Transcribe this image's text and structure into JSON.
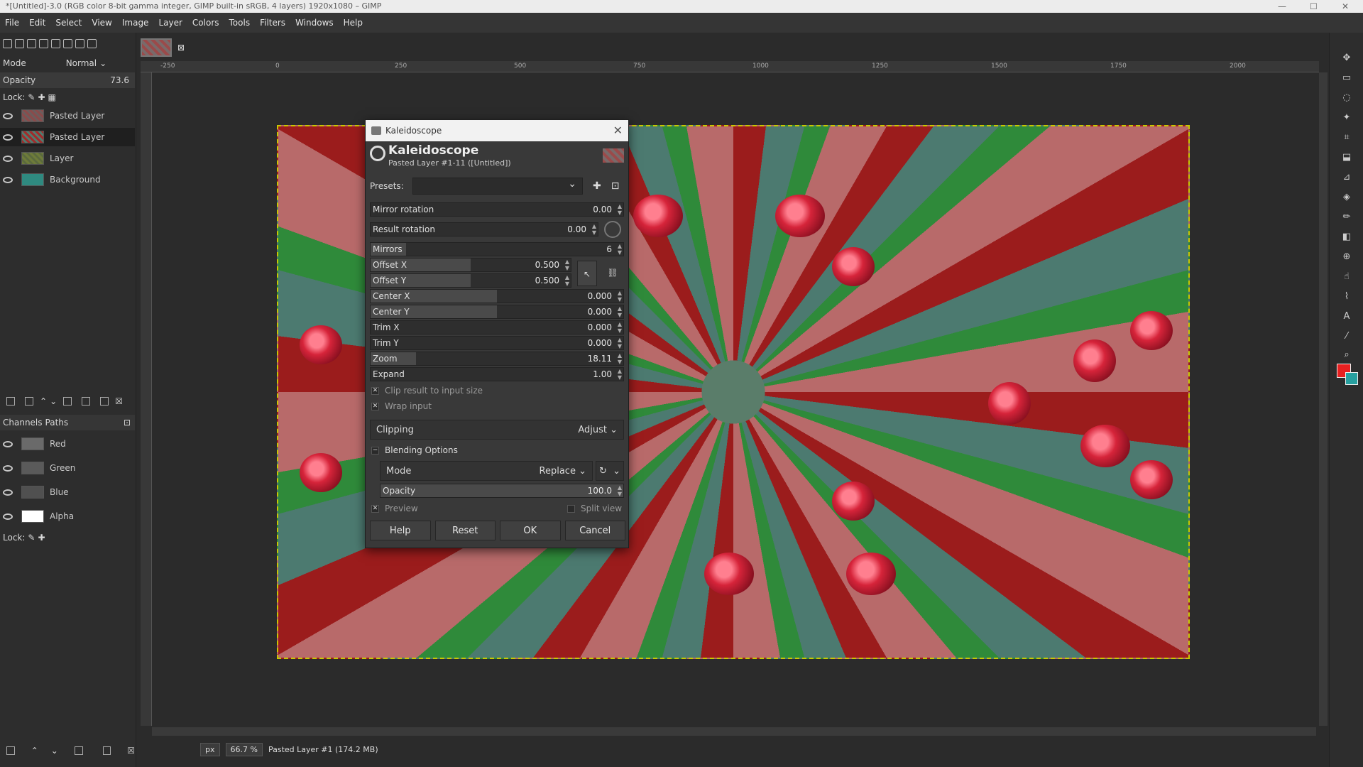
{
  "window": {
    "title": "*[Untitled]-3.0 (RGB color 8-bit gamma integer, GIMP built-in sRGB, 4 layers) 1920x1080 – GIMP"
  },
  "menu": [
    "File",
    "Edit",
    "Select",
    "View",
    "Image",
    "Layer",
    "Colors",
    "Tools",
    "Filters",
    "Windows",
    "Help"
  ],
  "layers_panel": {
    "mode_label": "Mode",
    "mode_value": "Normal",
    "opacity_label": "Opacity",
    "opacity_value": "73.6",
    "lock_label": "Lock:",
    "layers": [
      {
        "name": "Pasted Layer"
      },
      {
        "name": "Pasted Layer"
      },
      {
        "name": "Layer"
      },
      {
        "name": "Background"
      }
    ]
  },
  "channels_panel": {
    "tabs": [
      "Channels",
      "Paths"
    ],
    "channels": [
      {
        "name": "Red"
      },
      {
        "name": "Green"
      },
      {
        "name": "Blue"
      },
      {
        "name": "Alpha"
      }
    ],
    "lock_label": "Lock:"
  },
  "ruler": {
    "ticks": [
      "-250",
      "0",
      "250",
      "500",
      "750",
      "1000",
      "1250",
      "1500",
      "1750",
      "2000"
    ]
  },
  "status": {
    "unit": "px",
    "zoom": "66.7 %",
    "info": "Pasted Layer #1 (174.2 MB)"
  },
  "dialog": {
    "window_title": "Kaleidoscope",
    "heading": "Kaleidoscope",
    "subheading": "Pasted Layer #1-11 ([Untitled])",
    "presets_label": "Presets:",
    "params": [
      {
        "label": "Mirror rotation",
        "value": "0.00",
        "fill": 0.0
      },
      {
        "label": "Result rotation",
        "value": "0.00",
        "fill": 0.0
      },
      {
        "label": "Mirrors",
        "value": "6",
        "fill": 0.14
      },
      {
        "label": "Offset X",
        "value": "0.500",
        "fill": 0.5
      },
      {
        "label": "Offset Y",
        "value": "0.500",
        "fill": 0.5
      },
      {
        "label": "Center X",
        "value": "0.000",
        "fill": 0.5
      },
      {
        "label": "Center Y",
        "value": "0.000",
        "fill": 0.5
      },
      {
        "label": "Trim X",
        "value": "0.000",
        "fill": 0.0
      },
      {
        "label": "Trim Y",
        "value": "0.000",
        "fill": 0.0
      },
      {
        "label": "Zoom",
        "value": "18.11",
        "fill": 0.18
      },
      {
        "label": "Expand",
        "value": "1.00",
        "fill": 0.0
      }
    ],
    "clip_label": "Clip result to input size",
    "wrap_label": "Wrap input",
    "clipping_label": "Clipping",
    "clipping_value": "Adjust",
    "blending_label": "Blending Options",
    "mode_label": "Mode",
    "mode_value": "Replace",
    "opacity_label": "Opacity",
    "opacity_value": "100.0",
    "preview_label": "Preview",
    "split_label": "Split view",
    "buttons": {
      "help": "Help",
      "reset": "Reset",
      "ok": "OK",
      "cancel": "Cancel"
    }
  }
}
